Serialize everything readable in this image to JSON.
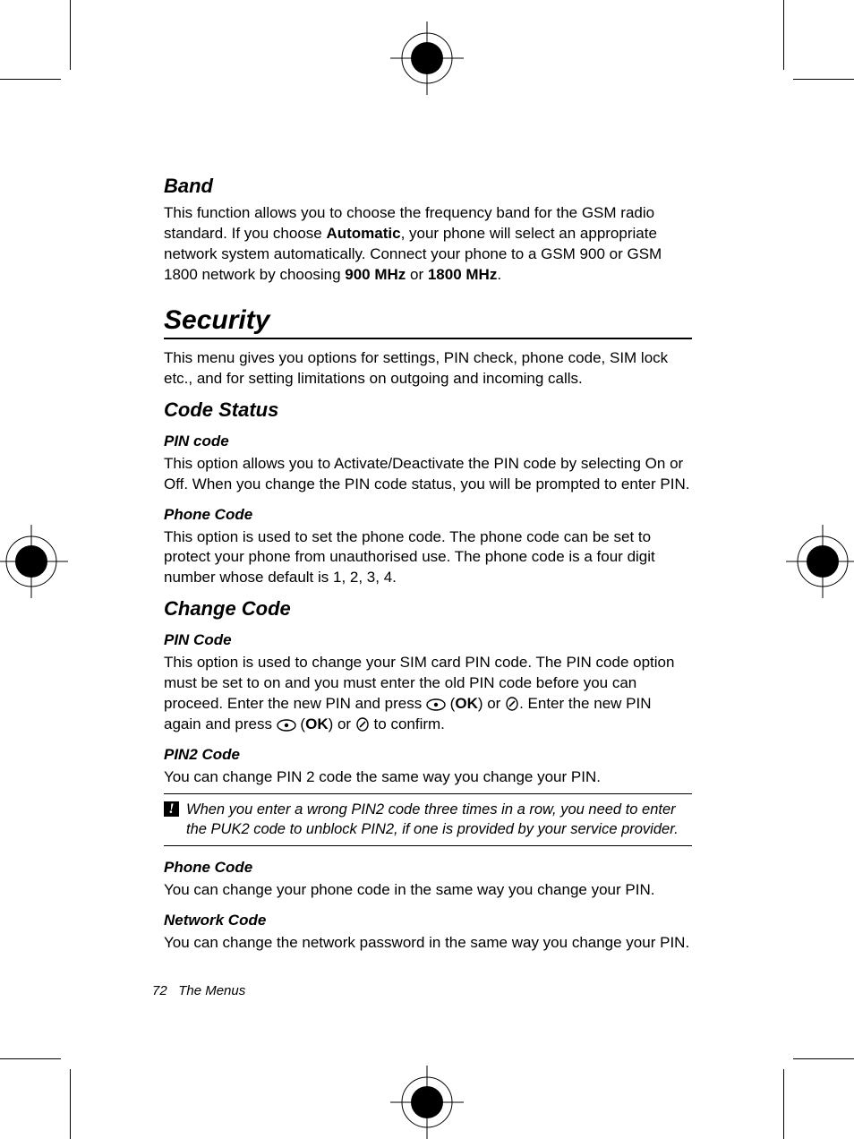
{
  "sections": {
    "band": {
      "heading": "Band",
      "p_pre": "This function allows you to choose the frequency band for the GSM radio standard. If you choose ",
      "b1": "Automatic",
      "p_mid": ", your phone will select an appropriate network system automatically. Connect your phone to a GSM 900 or GSM 1800 network by choosing ",
      "b2": "900 MHz",
      "or": " or ",
      "b3": "1800 MHz",
      "p_end": "."
    },
    "security": {
      "heading": "Security",
      "intro": "This menu gives you options for settings, PIN check, phone code, SIM lock etc., and for setting limitations on outgoing and incoming calls."
    },
    "code_status": {
      "heading": "Code Status",
      "pin_code_h": "PIN code",
      "pin_code_p": "This option allows you to Activate/Deactivate the PIN code by selecting On or Off. When you change the PIN code status, you will be prompted to enter PIN.",
      "phone_code_h": "Phone Code",
      "phone_code_p": "This option is used to set the phone code. The phone code can be set to protect your phone from unauthorised use. The phone code is a four digit number whose default is 1, 2, 3, 4."
    },
    "change_code": {
      "heading": "Change Code",
      "pin_code_h": "PIN Code",
      "pin_code_a": "This option is used to change your SIM card PIN code. The PIN code option must be set to on and you must enter the old PIN code before you can proceed. Enter the new PIN and press ",
      "ok1": "OK",
      "pin_code_b": ") or ",
      "pin_code_c": ". Enter the new PIN again and press ",
      "ok2": "OK",
      "pin_code_d": ") or ",
      "pin_code_e": " to confirm.",
      "pin2_h": "PIN2 Code",
      "pin2_p": "You can change PIN 2 code the same way you change your PIN.",
      "note": "When you enter a wrong PIN2 code three times in a row, you need to enter the PUK2 code to unblock PIN2, if one is provided by your service provider.",
      "phone_code_h": "Phone Code",
      "phone_code_p": "You can change your phone code in the same way you change your PIN.",
      "network_code_h": "Network Code",
      "network_code_p": "You can change the network password in the same way you change your PIN."
    }
  },
  "footer": {
    "page": "72",
    "label": "The Menus"
  },
  "icons": {
    "oval_button": "oval-button-icon",
    "round_button": "round-button-icon",
    "exclaim": "!"
  }
}
